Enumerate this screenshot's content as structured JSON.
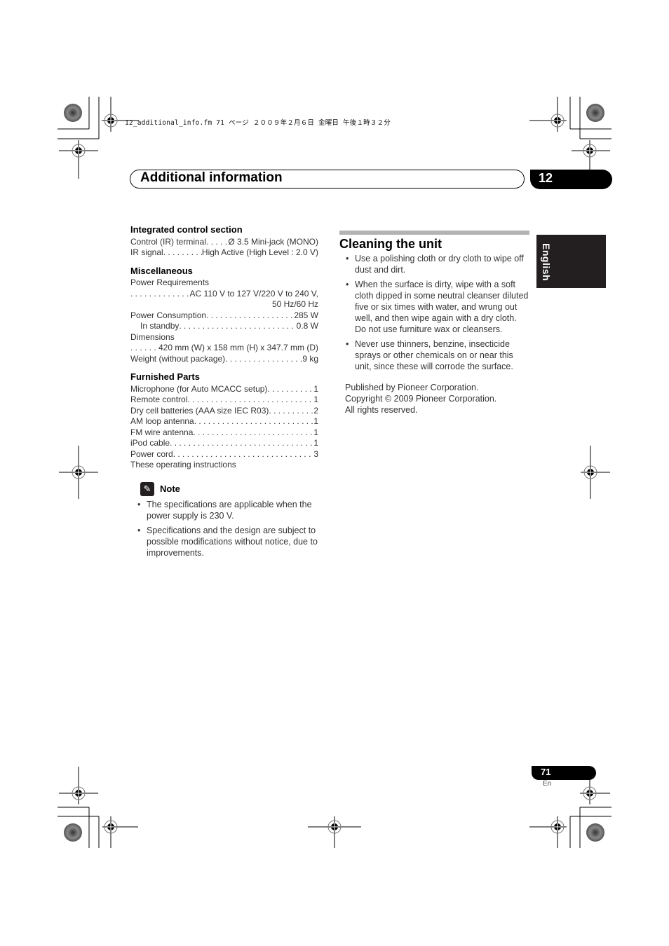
{
  "file_header": "12_additional_info.fm  71 ページ  ２００９年２月６日  金曜日  午後１時３２分",
  "chapter": {
    "title": "Additional information",
    "number": "12"
  },
  "language_tab": "English",
  "specs": {
    "integrated_control": {
      "heading": "Integrated control section",
      "rows": [
        {
          "label": "Control (IR) terminal",
          "value": "Ø 3.5 Mini-jack (MONO)"
        },
        {
          "label": "IR signal",
          "value": "High Active (High Level : 2.0 V)"
        }
      ]
    },
    "miscellaneous": {
      "heading": "Miscellaneous",
      "power_requirements_label": "Power Requirements",
      "power_requirements_value": "AC 110 V to 127 V/220 V to 240 V,",
      "power_requirements_value2": "50 Hz/60 Hz",
      "power_consumption_label": "Power Consumption",
      "power_consumption_value": "285 W",
      "standby_label": "In standby",
      "standby_value": "0.8 W",
      "dimensions_label": "Dimensions",
      "dimensions_value": "420 mm (W) x 158 mm (H) x 347.7 mm (D)",
      "weight_label": "Weight (without package)",
      "weight_value": "9 kg"
    },
    "furnished_parts": {
      "heading": "Furnished Parts",
      "items": [
        {
          "label": "Microphone (for Auto MCACC setup)",
          "qty": "1"
        },
        {
          "label": "Remote control",
          "qty": "1"
        },
        {
          "label": "Dry cell batteries (AAA size IEC R03)",
          "qty": "2"
        },
        {
          "label": "AM loop antenna",
          "qty": "1"
        },
        {
          "label": "FM wire antenna",
          "qty": "1"
        },
        {
          "label": "iPod cable",
          "qty": "1"
        },
        {
          "label": "Power cord",
          "qty": "3"
        }
      ],
      "last_item": "These operating instructions"
    }
  },
  "note": {
    "icon": "pencil-icon",
    "title": "Note",
    "items": [
      "The specifications are applicable when the power supply is 230 V.",
      "Specifications and the design are subject to possible modifications without notice, due to improvements."
    ]
  },
  "cleaning": {
    "title": "Cleaning the unit",
    "items": [
      "Use a polishing cloth or dry cloth to wipe off dust and dirt.",
      "When the surface is dirty, wipe with a soft cloth dipped in some neutral cleanser diluted five or six times with water, and wrung out well, and then wipe again with a dry cloth. Do not use furniture wax or cleansers.",
      "Never use thinners, benzine, insecticide sprays or other chemicals on or near this unit, since these will corrode the surface."
    ]
  },
  "publisher": {
    "line1": "Published by Pioneer Corporation.",
    "line2": "Copyright © 2009 Pioneer Corporation.",
    "line3": "All rights reserved."
  },
  "footer": {
    "page_number": "71",
    "language_code": "En"
  }
}
